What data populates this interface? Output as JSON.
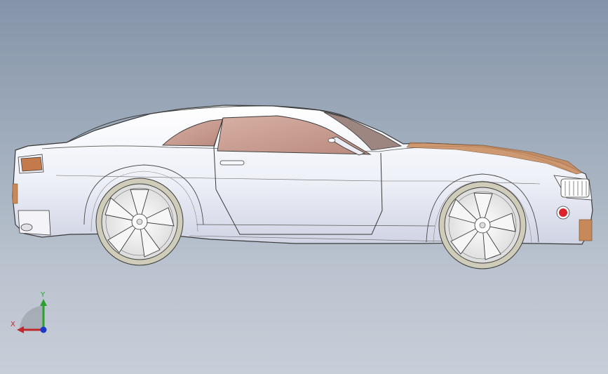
{
  "viewport": {
    "background_top": "#8594a9",
    "background_bottom": "#c8ced8"
  },
  "model": {
    "body_color": "#f3f4fb",
    "glass_color": "#c9a296",
    "edge_color": "#3a3a3a",
    "accent_color": "#c8895a",
    "wheel_color": "#e9e9e9",
    "tire_color": "#cfcdb9",
    "lamp_color": "#d9242b"
  },
  "triad": {
    "x_label": "X",
    "y_label": "Y",
    "x_color": "#c0282d",
    "y_color": "#2aa02e",
    "z_color": "#1c37c9"
  }
}
